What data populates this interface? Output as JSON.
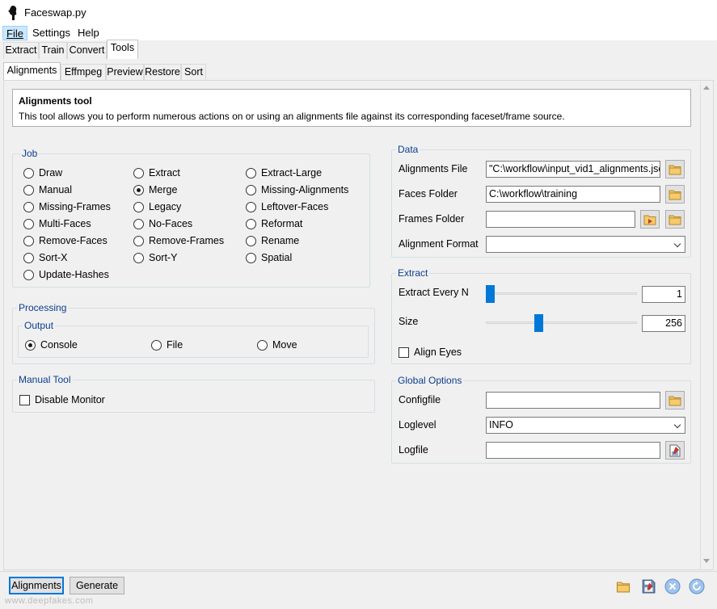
{
  "window": {
    "title": "Faceswap.py"
  },
  "menu": {
    "file": "File",
    "settings": "Settings",
    "help": "Help"
  },
  "tabs": {
    "extract": "Extract",
    "train": "Train",
    "convert": "Convert",
    "tools": "Tools"
  },
  "subtabs": {
    "alignments": "Alignments",
    "effmpeg": "Effmpeg",
    "preview": "Preview",
    "restore": "Restore",
    "sort": "Sort"
  },
  "info": {
    "title": "Alignments tool",
    "description": "This tool allows you to perform numerous actions on or using an alignments file against its corresponding faceset/frame source."
  },
  "job": {
    "label": "Job",
    "selected": "Merge",
    "options": [
      "Draw",
      "Extract",
      "Extract-Large",
      "Manual",
      "Merge",
      "Missing-Alignments",
      "Missing-Frames",
      "Legacy",
      "Leftover-Faces",
      "Multi-Faces",
      "No-Faces",
      "Reformat",
      "Remove-Faces",
      "Remove-Frames",
      "Rename",
      "Sort-X",
      "Sort-Y",
      "Spatial",
      "Update-Hashes"
    ]
  },
  "processing": {
    "label": "Processing",
    "output_label": "Output",
    "options": [
      "Console",
      "File",
      "Move"
    ],
    "selected": "Console"
  },
  "manual_tool": {
    "label": "Manual Tool",
    "disable_monitor": "Disable Monitor"
  },
  "data": {
    "label": "Data",
    "alignments_file_label": "Alignments File",
    "alignments_file_value": "\"C:\\workflow\\input_vid1_alignments.jsc",
    "faces_folder_label": "Faces Folder",
    "faces_folder_value": "C:\\workflow\\training",
    "frames_folder_label": "Frames Folder",
    "frames_folder_value": "",
    "alignment_format_label": "Alignment Format",
    "alignment_format_value": ""
  },
  "extract": {
    "label": "Extract",
    "every_n_label": "Extract Every N",
    "every_n_value": "1",
    "every_n_fraction": 0.0,
    "size_label": "Size",
    "size_value": "256",
    "size_fraction": 0.34,
    "align_eyes": "Align Eyes"
  },
  "global_options": {
    "label": "Global Options",
    "configfile_label": "Configfile",
    "configfile_value": "",
    "loglevel_label": "Loglevel",
    "loglevel_value": "INFO",
    "logfile_label": "Logfile",
    "logfile_value": ""
  },
  "bottom": {
    "alignments_button": "Alignments",
    "generate_button": "Generate",
    "watermark": "www.deepfakes.com"
  },
  "colors": {
    "accent": "#0078d7",
    "group_label": "#0b3e90",
    "folder": "#e8b649"
  }
}
